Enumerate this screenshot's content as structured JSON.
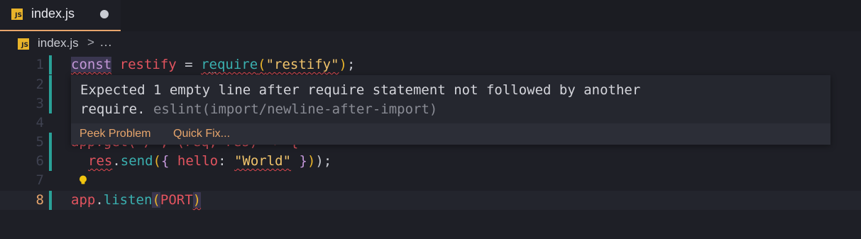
{
  "tab": {
    "label": "index.js",
    "icon": "js-file-icon",
    "badge": "JS",
    "dirty": true
  },
  "breadcrumb": {
    "file": "index.js",
    "separator": ">",
    "more": "..."
  },
  "editor": {
    "active_line": 8,
    "line_numbers": [
      "1",
      "2",
      "3",
      "4",
      "5",
      "6",
      "7",
      "8"
    ],
    "lines": {
      "l1": {
        "kw": "const",
        "var": "restify",
        "eq": " = ",
        "fn": "require",
        "open": "(",
        "str": "\"restify\"",
        "close": ")",
        "semi": ";"
      },
      "l6": {
        "obj": "res",
        "dot": ".",
        "fn": "send",
        "open": "(",
        "brace_open": "{",
        "key": " hello",
        "colon": ": ",
        "str": "\"World\"",
        "brace_close": " }",
        "close": ")",
        "semi": ");"
      },
      "l8": {
        "obj": "app",
        "dot": ".",
        "fn": "listen",
        "open": "(",
        "arg": "PORT",
        "close": ")"
      }
    },
    "partial_line5": "app.get(\"/\", (req, res) => {"
  },
  "hover": {
    "message_line1": "Expected 1 empty line after require statement not followed by another",
    "message_line2": "require.",
    "source": "eslint(import/newline-after-import)",
    "actions": {
      "peek": "Peek Problem",
      "quick_fix": "Quick Fix..."
    }
  },
  "colors": {
    "accent": "#e7a56c",
    "gutter_modified": "#2aa198",
    "error": "#e0484f"
  }
}
